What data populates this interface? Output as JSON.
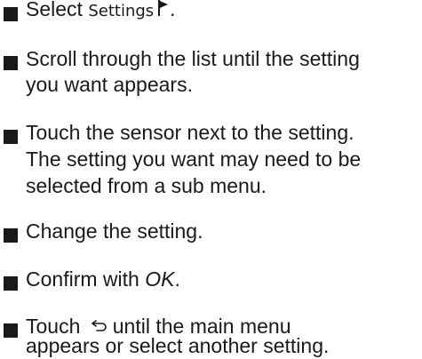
{
  "steps": [
    {
      "prefix": "Select ",
      "ui_label": "Settings",
      "icon": "flag-icon",
      "suffix": "."
    },
    {
      "lines": [
        "Scroll through the list until the setting",
        "you want appears."
      ]
    },
    {
      "lines": [
        "Touch the sensor next to the setting.",
        "The setting you want may need to be",
        "selected from a sub menu."
      ]
    },
    {
      "lines": [
        "Change the setting."
      ]
    },
    {
      "prefix": "Confirm with ",
      "italic": "OK",
      "suffix": "."
    },
    {
      "prefix": "Touch ",
      "icon": "back-arrow-icon",
      "rest": "until the main menu",
      "line2": "appears or select another setting."
    }
  ]
}
